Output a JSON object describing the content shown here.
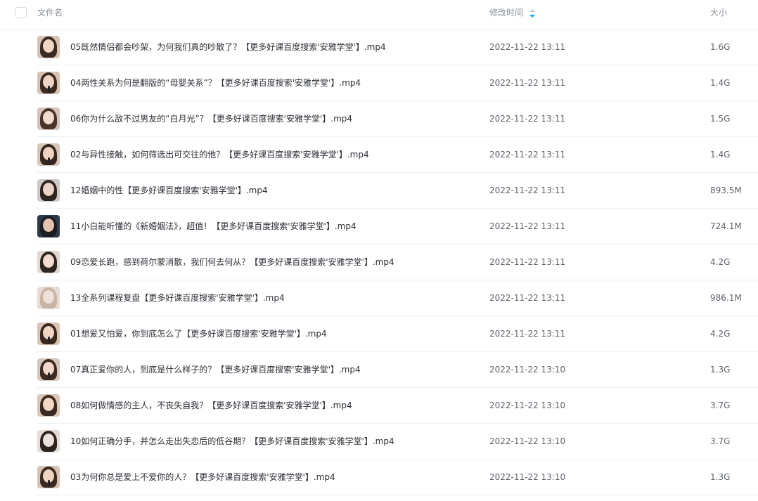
{
  "header": {
    "name_label": "文件名",
    "time_label": "修改时间",
    "size_label": "大小",
    "sort_color": "#06a7ff"
  },
  "files": [
    {
      "name": "05既然情侣都会吵架，为何我们真的吵散了？【更多好课百度搜索'安雅学堂'】.mp4",
      "time": "2022-11-22 13:11",
      "size": "1.6G",
      "thumb": {
        "bg": "#d9c3b4",
        "hair": "#3a2a22",
        "face": "#f1d6c6",
        "mic": false
      }
    },
    {
      "name": "04两性关系为何是翻版的“母婴关系”？【更多好课百度搜索'安雅学堂'】.mp4",
      "time": "2022-11-22 13:11",
      "size": "1.4G",
      "thumb": {
        "bg": "#d7c2b2",
        "hair": "#3b2a20",
        "face": "#f0d4c3",
        "mic": true
      }
    },
    {
      "name": "06你为什么敌不过男友的“白月光”？【更多好课百度搜索'安雅学堂'】.mp4",
      "time": "2022-11-22 13:11",
      "size": "1.5G",
      "thumb": {
        "bg": "#d4c4bd",
        "hair": "#4a3328",
        "face": "#f2d9cd",
        "mic": false
      }
    },
    {
      "name": "02与异性接触，如何筛选出可交往的他？【更多好课百度搜索'安雅学堂'】.mp4",
      "time": "2022-11-22 13:11",
      "size": "1.4G",
      "thumb": {
        "bg": "#d8c6b9",
        "hair": "#35261f",
        "face": "#efd3c2",
        "mic": true
      }
    },
    {
      "name": "12婚姻中的性【更多好课百度搜索'安雅学堂'】.mp4",
      "time": "2022-11-22 13:11",
      "size": "893.5M",
      "thumb": {
        "bg": "#cfcac7",
        "hair": "#2e2420",
        "face": "#ead2c5",
        "mic": false
      }
    },
    {
      "name": "11小白能听懂的《新婚姻法》，超值！【更多好课百度搜索'安雅学堂'】.mp4",
      "time": "2022-11-22 13:11",
      "size": "724.1M",
      "thumb": {
        "bg": "#2e3b4a",
        "hair": "#1c1c22",
        "face": "#e3c3b0",
        "mic": false
      }
    },
    {
      "name": "09恋爱长跑，感到荷尔蒙消散，我们何去何从？【更多好课百度搜索'安雅学堂'】.mp4",
      "time": "2022-11-22 13:11",
      "size": "4.2G",
      "thumb": {
        "bg": "#e2d8d2",
        "hair": "#2f2520",
        "face": "#f3dccf",
        "mic": false
      }
    },
    {
      "name": "13全系列课程复盘【更多好课百度搜索'安雅学堂'】.mp4",
      "time": "2022-11-22 13:11",
      "size": "986.1M",
      "thumb": {
        "bg": "#e6dcd4",
        "hair": "#c9b3a4",
        "face": "#efe1d8",
        "mic": false
      }
    },
    {
      "name": "01想爱又怕爱，你到底怎么了【更多好课百度搜索'安雅学堂'】.mp4",
      "time": "2022-11-22 13:11",
      "size": "4.2G",
      "thumb": {
        "bg": "#d8c4b5",
        "hair": "#3a281f",
        "face": "#f0d5c4",
        "mic": true
      }
    },
    {
      "name": "07真正爱你的人，到底是什么样子的？【更多好课百度搜索'安雅学堂'】.mp4",
      "time": "2022-11-22 13:10",
      "size": "1.3G",
      "thumb": {
        "bg": "#d6c8bf",
        "hair": "#3d2b22",
        "face": "#f1d8ca",
        "mic": true
      }
    },
    {
      "name": "08如何做情感的主人，不丧失自我？【更多好课百度搜索'安雅学堂'】.mp4",
      "time": "2022-11-22 13:10",
      "size": "3.7G",
      "thumb": {
        "bg": "#dcc7b6",
        "hair": "#3a2920",
        "face": "#f2d7c5",
        "mic": false
      }
    },
    {
      "name": "10如何正确分手，并怎么走出失恋后的低谷期？【更多好课百度搜索'安雅学堂'】.mp4",
      "time": "2022-11-22 13:10",
      "size": "3.7G",
      "thumb": {
        "bg": "#e4dcd6",
        "hair": "#2c2420",
        "face": "#ece0d8",
        "mic": false
      }
    },
    {
      "name": "03为何你总是爱上不爱你的人？【更多好课百度搜索'安雅学堂'】.mp4",
      "time": "2022-11-22 13:10",
      "size": "1.3G",
      "thumb": {
        "bg": "#d8c3b3",
        "hair": "#3a2920",
        "face": "#f0d4c2",
        "mic": true
      }
    }
  ]
}
